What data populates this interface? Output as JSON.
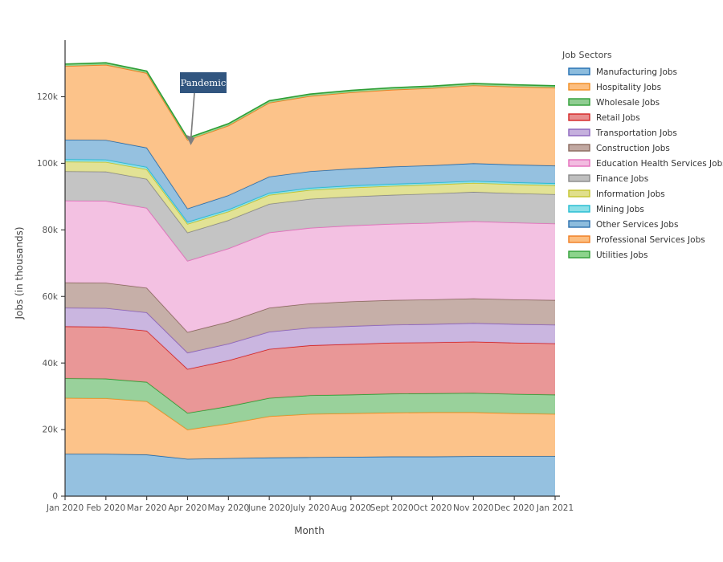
{
  "chart_data": {
    "type": "area",
    "stacked": true,
    "title": "",
    "xlabel": "Month",
    "ylabel": "Jobs (in thousands)",
    "legend_title": "Job Sectors",
    "legend_position": "right",
    "grid": false,
    "xlim_categories": true,
    "ylim": [
      0,
      137
    ],
    "ytick_labels": [
      "0",
      "20k",
      "40k",
      "60k",
      "80k",
      "100k",
      "120k"
    ],
    "ytick_values": [
      0,
      20000,
      40000,
      60000,
      80000,
      100000,
      120000
    ],
    "categories": [
      "Jan 2020",
      "Feb 2020",
      "Mar 2020",
      "Apr 2020",
      "May 2020",
      "June 2020",
      "July 2020",
      "Aug 2020",
      "Sept 2020",
      "Oct 2020",
      "Nov 2020",
      "Dec 2020",
      "Jan 2021"
    ],
    "series": [
      {
        "name": "Manufacturing Jobs",
        "color": "#8cbcdd",
        "line": "#1f6cb0",
        "values": [
          12.7,
          12.7,
          12.5,
          11.2,
          11.4,
          11.6,
          11.7,
          11.8,
          11.9,
          11.9,
          12.0,
          12.0,
          12.0
        ]
      },
      {
        "name": "Hospitality Jobs",
        "color": "#fcbe80",
        "line": "#f08c1f",
        "values": [
          16.8,
          16.7,
          16.0,
          8.8,
          10.4,
          12.4,
          13.0,
          13.1,
          13.2,
          13.3,
          13.2,
          12.9,
          12.7
        ]
      },
      {
        "name": "Wholesale Jobs",
        "color": "#90cd92",
        "line": "#2f9e36",
        "values": [
          5.9,
          5.9,
          5.8,
          5.0,
          5.2,
          5.5,
          5.6,
          5.6,
          5.7,
          5.7,
          5.8,
          5.8,
          5.8
        ]
      },
      {
        "name": "Retail Jobs",
        "color": "#e78e8e",
        "line": "#d42424",
        "values": [
          15.6,
          15.6,
          15.4,
          13.2,
          13.8,
          14.7,
          15.0,
          15.2,
          15.3,
          15.3,
          15.4,
          15.4,
          15.4
        ]
      },
      {
        "name": "Transportation Jobs",
        "color": "#c5b0dd",
        "line": "#8c64bd",
        "values": [
          5.6,
          5.6,
          5.5,
          4.9,
          5.0,
          5.2,
          5.3,
          5.4,
          5.4,
          5.5,
          5.6,
          5.6,
          5.6
        ]
      },
      {
        "name": "Construction Jobs",
        "color": "#c1a8a1",
        "line": "#8a6a5e",
        "values": [
          7.6,
          7.6,
          7.4,
          6.2,
          6.6,
          7.2,
          7.3,
          7.4,
          7.4,
          7.4,
          7.4,
          7.4,
          7.4
        ]
      },
      {
        "name": "Education Health Services Jobs",
        "color": "#f2bce0",
        "line": "#e36cbb",
        "values": [
          24.6,
          24.6,
          24.0,
          21.4,
          22.0,
          22.6,
          22.7,
          22.8,
          22.9,
          23.0,
          23.2,
          23.1,
          23.0
        ]
      },
      {
        "name": "Finance Jobs",
        "color": "#bfbfbf",
        "line": "#8a8a8a",
        "values": [
          8.8,
          8.8,
          8.7,
          8.5,
          8.5,
          8.6,
          8.7,
          8.7,
          8.7,
          8.8,
          8.8,
          8.8,
          8.8
        ]
      },
      {
        "name": "Information Jobs",
        "color": "#e0df8c",
        "line": "#c3c32b",
        "values": [
          2.9,
          2.9,
          2.9,
          2.6,
          2.6,
          2.7,
          2.7,
          2.7,
          2.7,
          2.7,
          2.7,
          2.7,
          2.7
        ]
      },
      {
        "name": "Mining Jobs",
        "color": "#8ce0e8",
        "line": "#23bcd1",
        "values": [
          0.7,
          0.7,
          0.7,
          0.6,
          0.6,
          0.6,
          0.6,
          0.6,
          0.6,
          0.6,
          0.6,
          0.6,
          0.6
        ]
      },
      {
        "name": "Other Services Jobs",
        "color": "#8cbcdd",
        "line": "#2a6fad",
        "values": [
          5.9,
          5.9,
          5.8,
          4.0,
          4.3,
          4.9,
          5.0,
          5.1,
          5.2,
          5.2,
          5.3,
          5.3,
          5.3
        ]
      },
      {
        "name": "Professional Services Jobs",
        "color": "#fcbe80",
        "line": "#f07c1f",
        "values": [
          22.1,
          22.6,
          22.4,
          20.6,
          20.9,
          22.2,
          22.6,
          22.9,
          23.1,
          23.2,
          23.4,
          23.4,
          23.4
        ]
      },
      {
        "name": "Utilities Jobs",
        "color": "#8cd48c",
        "line": "#2f9e36",
        "values": [
          0.6,
          0.6,
          0.6,
          0.6,
          0.6,
          0.6,
          0.6,
          0.6,
          0.6,
          0.6,
          0.6,
          0.6,
          0.6
        ]
      }
    ],
    "totals": [
      129.8,
      130.2,
      127.7,
      107.6,
      111.9,
      118.8,
      120.8,
      121.9,
      122.7,
      123.2,
      124.0,
      123.6,
      123.3
    ],
    "annotations": [
      {
        "text": "Pandemic",
        "box_color": "#31557f",
        "text_color": "#ffffff",
        "arrow_color": "#7f7f7f",
        "x_category": "Apr 2020"
      }
    ]
  },
  "legend": {
    "title": "Job Sectors",
    "entries": [
      {
        "label": "Manufacturing Jobs",
        "color": "#8cbcdd"
      },
      {
        "label": "Hospitality Jobs",
        "color": "#fcbe80"
      },
      {
        "label": "Wholesale Jobs",
        "color": "#90cd92"
      },
      {
        "label": "Retail Jobs",
        "color": "#e78e8e"
      },
      {
        "label": "Transportation Jobs",
        "color": "#c5b0dd"
      },
      {
        "label": "Construction Jobs",
        "color": "#c1a8a1"
      },
      {
        "label": "Education Health Services Jobs",
        "color": "#f2bce0"
      },
      {
        "label": "Finance Jobs",
        "color": "#bfbfbf"
      },
      {
        "label": "Information Jobs",
        "color": "#e0df8c"
      },
      {
        "label": "Mining Jobs",
        "color": "#8ce0e8"
      },
      {
        "label": "Other Services Jobs",
        "color": "#8cbcdd"
      },
      {
        "label": "Professional Services Jobs",
        "color": "#fcbe80"
      },
      {
        "label": "Utilities Jobs",
        "color": "#8cd48c"
      }
    ]
  },
  "axes": {
    "x_title": "Month",
    "y_title": "Jobs (in thousands)"
  }
}
